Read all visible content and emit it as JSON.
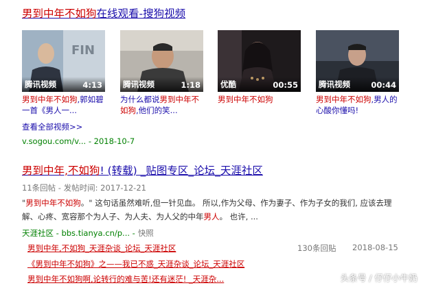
{
  "result1": {
    "title_hl": "男到中年不如狗",
    "title_rest": "在线观看-搜狗视频",
    "videos": [
      {
        "source": "腾讯视频",
        "duration": "4:13",
        "desc_hl": "男到中年不如狗",
        "desc": ",郭如碧一首《男人一..."
      },
      {
        "source": "腾讯视频",
        "duration": "1:18",
        "desc": "为什么都说",
        "desc_hl": "男到中年不如狗",
        "desc2": ",他们的笑..."
      },
      {
        "source": "优酷",
        "duration": "00:55",
        "desc_hl": "男到中年不如狗"
      },
      {
        "source": "腾讯视频",
        "duration": "00:44",
        "desc_hl": "男到中年不如狗",
        "desc": ",男人的心酸你懂吗!"
      }
    ],
    "more_link": "查看全部视频>>",
    "url": "v.sogou.com/v... - 2018-10-7"
  },
  "result2": {
    "title_hl": "男到中年,不如狗",
    "title_rest": "! (转载) _贴图专区_论坛_天涯社区",
    "meta": "11条回帖 - 发帖时间: 2017-12-21",
    "snippet_q1": "\"",
    "snippet_hl1": "男到中年不如狗",
    "snippet_a": "。\" 这句话虽然难听,但一针见血。 所以,作为父母、作为妻子、作为子女的我们, 应该去理解、心疼、宽容那个为人子、为人夫、为人父的中年",
    "snippet_hl2": "男人",
    "snippet_b": "。 也许, ...",
    "url": "天涯社区 - bbs.tianya.cn/p... -",
    "snapshot": "快照",
    "sub_results": [
      {
        "title": "男到中年,不如狗_天涯杂谈_论坛_天涯社区",
        "replies": "130条回贴",
        "date": "2018-08-15"
      },
      {
        "title": "《男到中年不如狗》之——我已不惑_天涯杂谈_论坛_天涯社区"
      },
      {
        "title": "男到中年不如狗啊,论转行的难与苦!还有迷茫! _天涯杂..."
      }
    ]
  },
  "watermark": "头条号 / 仔仔小牛奶"
}
